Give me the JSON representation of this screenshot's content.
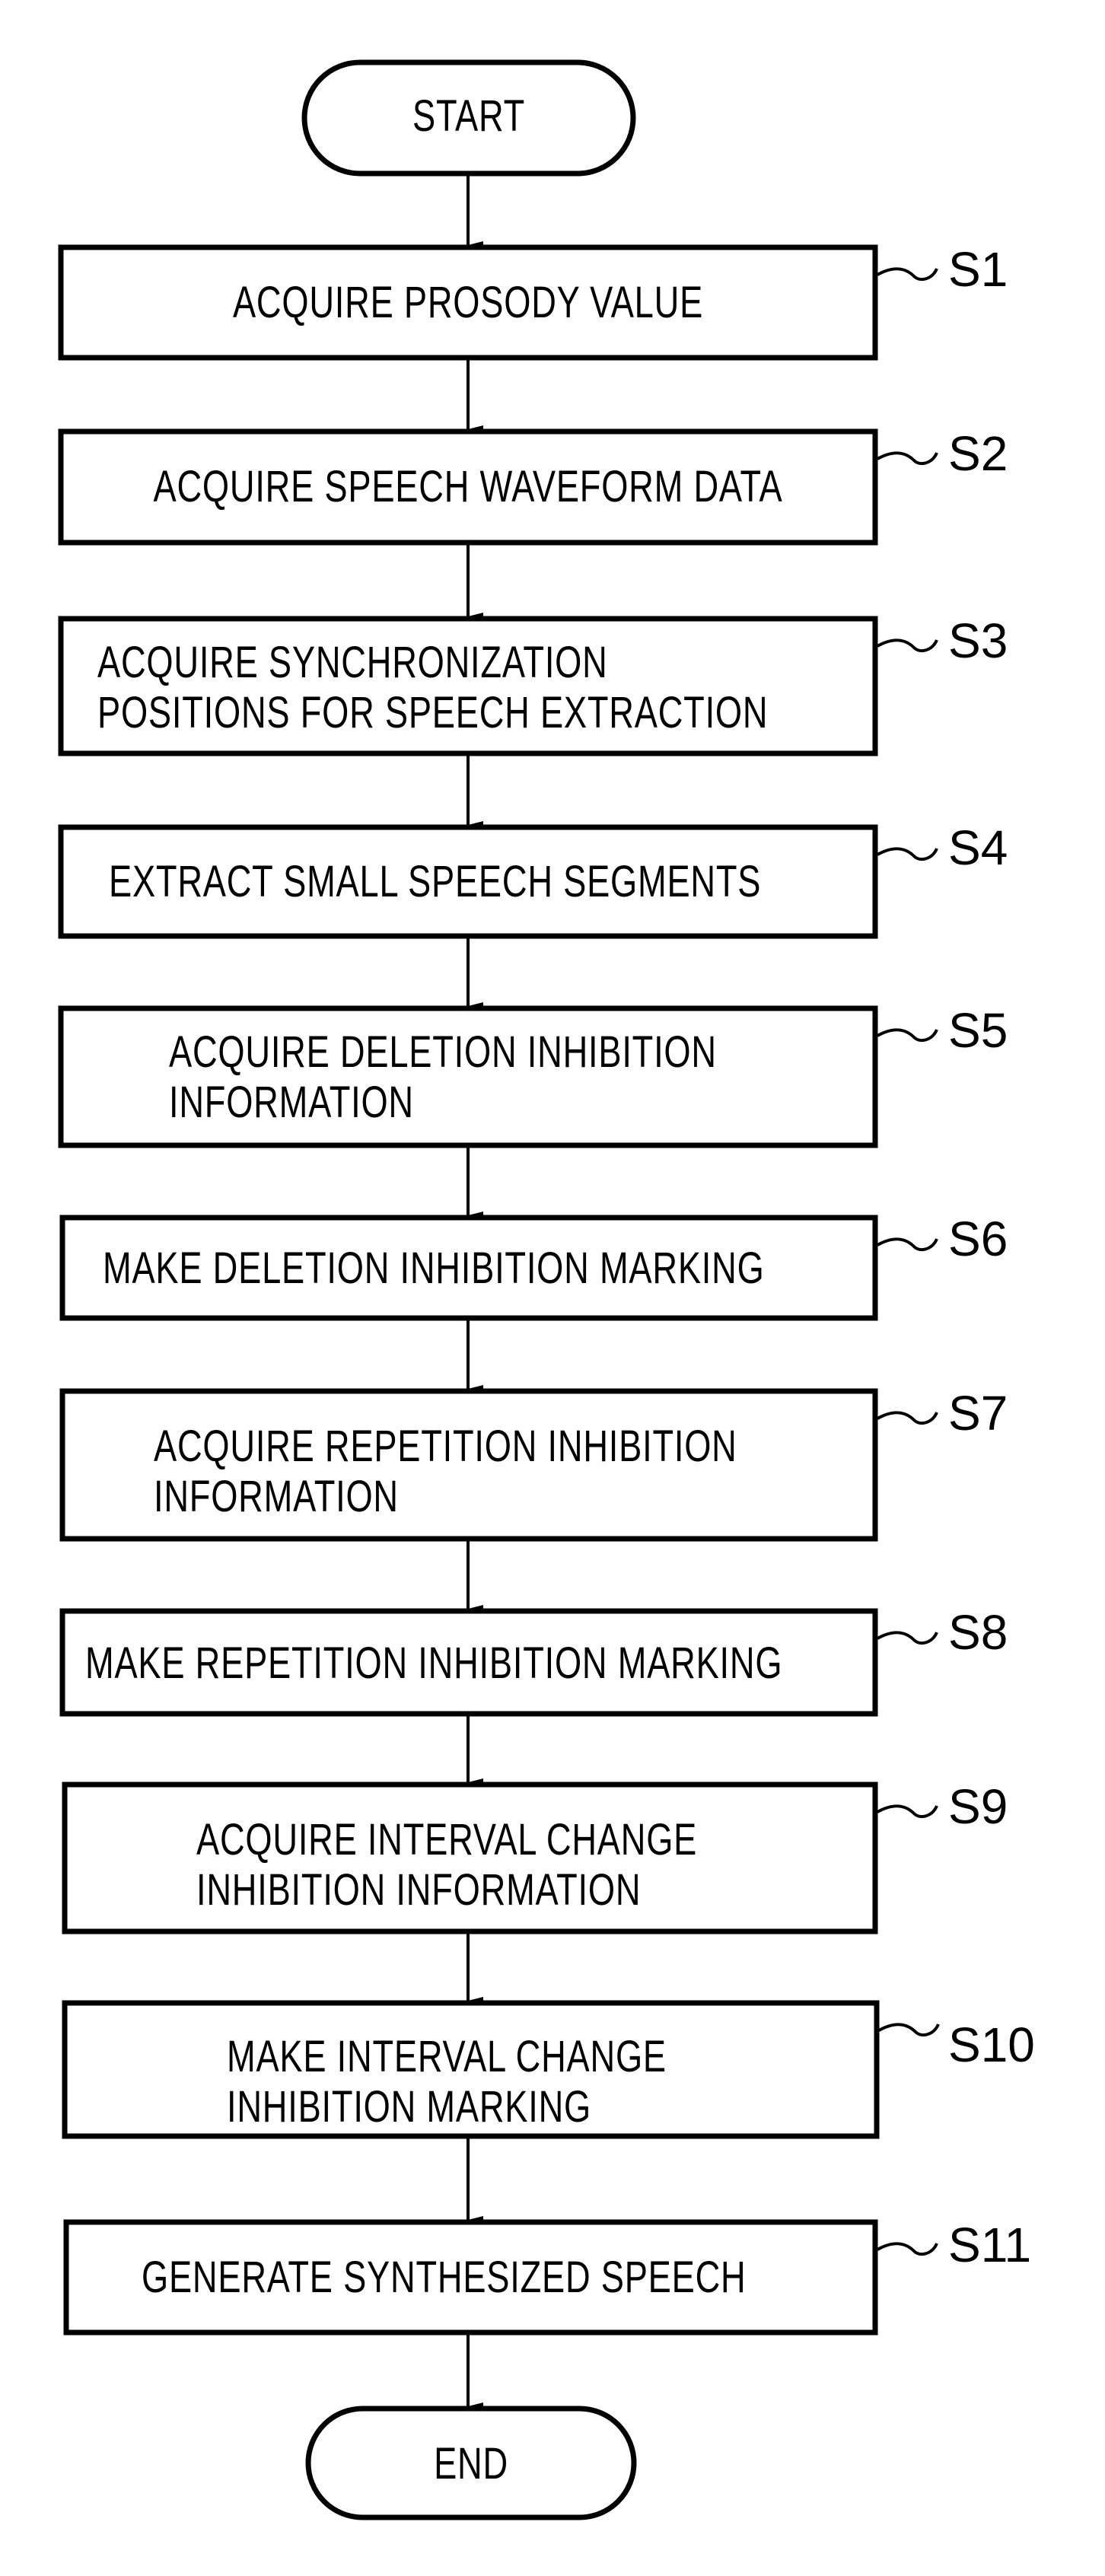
{
  "diagram": {
    "type": "flowchart",
    "terminals": {
      "start": "START",
      "end": "END"
    },
    "steps": [
      {
        "id": "S1",
        "lines": [
          "ACQUIRE PROSODY VALUE"
        ]
      },
      {
        "id": "S2",
        "lines": [
          "ACQUIRE SPEECH WAVEFORM DATA"
        ]
      },
      {
        "id": "S3",
        "lines": [
          "ACQUIRE SYNCHRONIZATION",
          "POSITIONS FOR SPEECH EXTRACTION"
        ]
      },
      {
        "id": "S4",
        "lines": [
          "EXTRACT SMALL SPEECH SEGMENTS"
        ]
      },
      {
        "id": "S5",
        "lines": [
          "ACQUIRE DELETION INHIBITION",
          "INFORMATION"
        ]
      },
      {
        "id": "S6",
        "lines": [
          "MAKE DELETION INHIBITION MARKING"
        ]
      },
      {
        "id": "S7",
        "lines": [
          "ACQUIRE REPETITION INHIBITION",
          "INFORMATION"
        ]
      },
      {
        "id": "S8",
        "lines": [
          "MAKE REPETITION INHIBITION MARKING"
        ]
      },
      {
        "id": "S9",
        "lines": [
          "ACQUIRE INTERVAL CHANGE",
          "INHIBITION INFORMATION"
        ]
      },
      {
        "id": "S10",
        "lines": [
          "MAKE INTERVAL CHANGE",
          "INHIBITION MARKING"
        ]
      },
      {
        "id": "S11",
        "lines": [
          "GENERATE SYNTHESIZED SPEECH"
        ]
      }
    ],
    "edges": [
      [
        "START",
        "S1"
      ],
      [
        "S1",
        "S2"
      ],
      [
        "S2",
        "S3"
      ],
      [
        "S3",
        "S4"
      ],
      [
        "S4",
        "S5"
      ],
      [
        "S5",
        "S6"
      ],
      [
        "S6",
        "S7"
      ],
      [
        "S7",
        "S8"
      ],
      [
        "S8",
        "S9"
      ],
      [
        "S9",
        "S10"
      ],
      [
        "S10",
        "S11"
      ],
      [
        "S11",
        "END"
      ]
    ]
  }
}
